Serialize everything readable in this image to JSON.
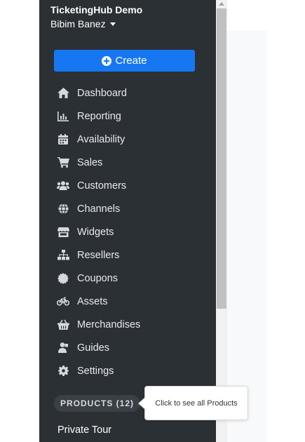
{
  "sidebar": {
    "org_name": "TicketingHub Demo",
    "user_name": "Bibim Banez",
    "create_label": "Create",
    "nav_items": [
      {
        "label": "Dashboard",
        "icon": "home-icon"
      },
      {
        "label": "Reporting",
        "icon": "bar-chart-icon"
      },
      {
        "label": "Availability",
        "icon": "calendar-icon"
      },
      {
        "label": "Sales",
        "icon": "cart-icon"
      },
      {
        "label": "Customers",
        "icon": "users-icon"
      },
      {
        "label": "Channels",
        "icon": "globe-icon"
      },
      {
        "label": "Widgets",
        "icon": "store-icon"
      },
      {
        "label": "Resellers",
        "icon": "sitemap-icon"
      },
      {
        "label": "Coupons",
        "icon": "certificate-icon"
      },
      {
        "label": "Assets",
        "icon": "bicycle-icon"
      },
      {
        "label": "Merchandises",
        "icon": "basket-icon"
      },
      {
        "label": "Guides",
        "icon": "user-tie-icon"
      },
      {
        "label": "Settings",
        "icon": "cog-icon"
      }
    ],
    "products_label": "PRODUCTS (12)",
    "product_items": [
      "Private Tour"
    ]
  },
  "tooltip": {
    "text": "Click to see all Products"
  },
  "colors": {
    "sidebar_bg": "#2b3035",
    "accent": "#1777f2",
    "text": "#e8eaec"
  }
}
